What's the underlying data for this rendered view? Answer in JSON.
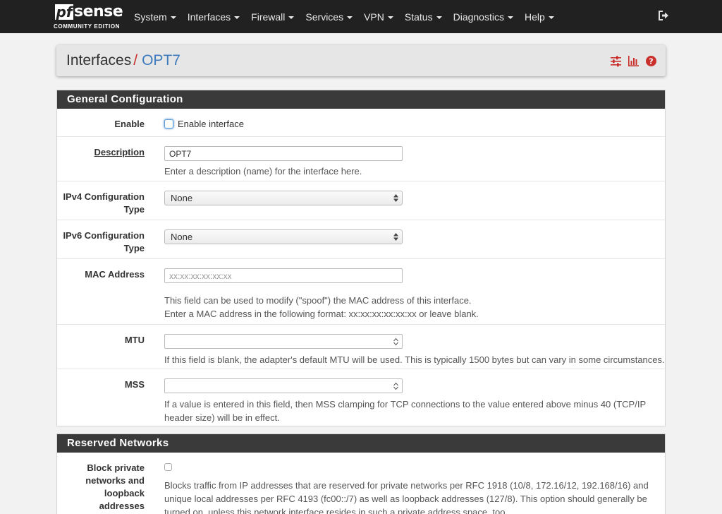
{
  "brand": {
    "logo_main": "sense",
    "logo_prefix": "pf",
    "edition": "COMMUNITY EDITION"
  },
  "nav": {
    "items": [
      {
        "label": "System"
      },
      {
        "label": "Interfaces"
      },
      {
        "label": "Firewall"
      },
      {
        "label": "Services"
      },
      {
        "label": "VPN"
      },
      {
        "label": "Status"
      },
      {
        "label": "Diagnostics"
      },
      {
        "label": "Help"
      }
    ],
    "logout_icon": "sign-out-icon"
  },
  "breadcrumb": {
    "root": "Interfaces",
    "separator": "/",
    "current": "OPT7"
  },
  "header_icons": [
    "sliders-icon",
    "bar-chart-icon",
    "question-circle-icon"
  ],
  "general": {
    "heading": "General Configuration",
    "enable": {
      "label": "Enable",
      "checkbox_label": "Enable interface"
    },
    "description": {
      "label": "Description",
      "value": "OPT7",
      "help": "Enter a description (name) for the interface here."
    },
    "ipv4": {
      "label_line1": "IPv4 Configuration",
      "label_line2": "Type",
      "value": "None"
    },
    "ipv6": {
      "label_line1": "IPv6 Configuration",
      "label_line2": "Type",
      "value": "None"
    },
    "mac": {
      "label": "MAC Address",
      "placeholder": "xx:xx:xx:xx:xx:xx",
      "help_line1": "This field can be used to modify (\"spoof\") the MAC address of this interface.",
      "help_line2": "Enter a MAC address in the following format: xx:xx:xx:xx:xx:xx or leave blank."
    },
    "mtu": {
      "label": "MTU",
      "help": "If this field is blank, the adapter's default MTU will be used. This is typically 1500 bytes but can vary in some circumstances."
    },
    "mss": {
      "label": "MSS",
      "help_line1": "If a value is entered in this field, then MSS clamping for TCP connections to the value entered above minus 40 (TCP/IP",
      "help_line2": "header size) will be in effect."
    }
  },
  "reserved": {
    "heading": "Reserved Networks",
    "block_private": {
      "label_line1": "Block private",
      "label_line2": "networks and",
      "label_line3": "loopback addresses",
      "help_line1": "Blocks traffic from IP addresses that are reserved for private networks per RFC 1918 (10/8, 172.16/12, 192.168/16) and",
      "help_line2": "unique local addresses per RFC 4193 (fc00::/7) as well as loopback addresses (127/8). This option should generally be",
      "help_line3": "turned on, unless this network interface resides in such a private address space, too."
    }
  },
  "colors": {
    "navbar": "#212121",
    "accent_red": "#c9302c",
    "link_blue": "#3c7bbd",
    "panel_heading": "#3a3a3a"
  }
}
